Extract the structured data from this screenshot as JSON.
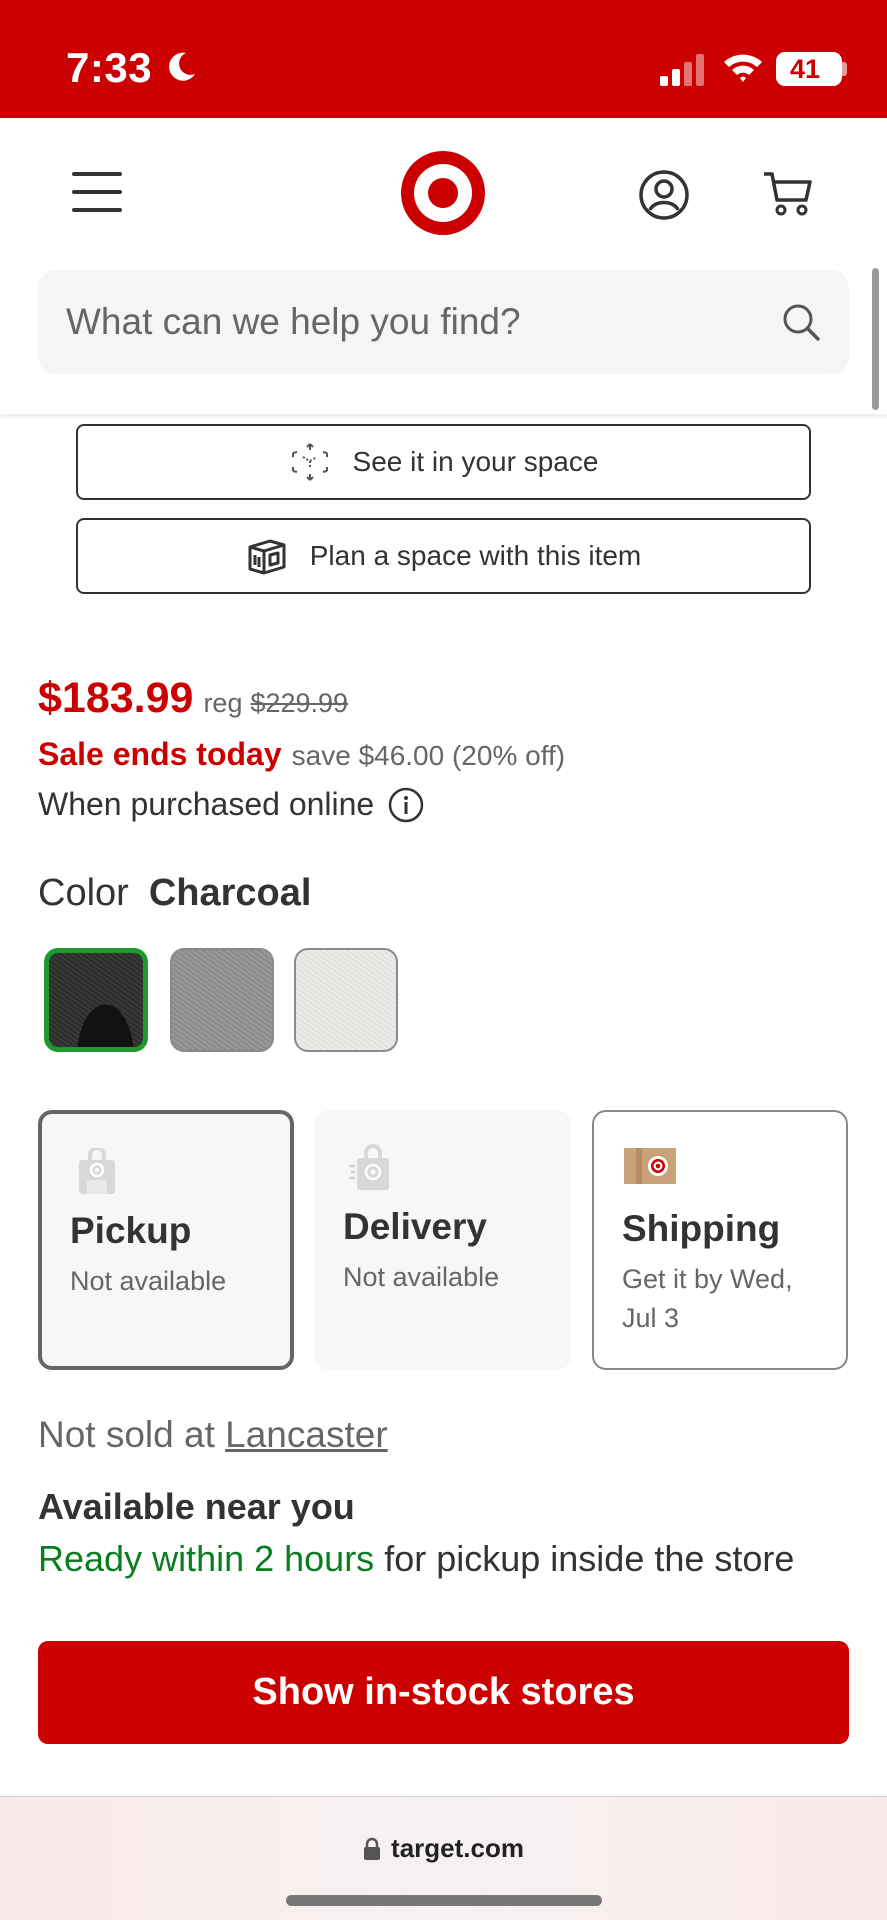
{
  "status_bar": {
    "time": "7:33",
    "battery": "41"
  },
  "header": {
    "search_placeholder": "What can we help you find?"
  },
  "actions": {
    "see_in_space": "See it in your space",
    "plan_space": "Plan a space with this item"
  },
  "pricing": {
    "price": "$183.99",
    "reg_label": "reg",
    "reg_price": "$229.99",
    "sale_ends": "Sale ends today",
    "save_text": "save $46.00 (20% off)",
    "purchased_online": "When purchased online"
  },
  "color": {
    "label": "Color",
    "selected": "Charcoal",
    "swatches": [
      "Charcoal",
      "Gray",
      "White"
    ]
  },
  "fulfillment": {
    "pickup": {
      "title": "Pickup",
      "status": "Not available"
    },
    "delivery": {
      "title": "Delivery",
      "status": "Not available"
    },
    "shipping": {
      "title": "Shipping",
      "status": "Get it by Wed, Jul 3"
    }
  },
  "store": {
    "not_sold_prefix": "Not sold at",
    "store_name": "Lancaster",
    "available_title": "Available near you",
    "ready_highlight": "Ready within 2 hours",
    "ready_rest": "for pickup inside the store"
  },
  "cta": {
    "show_stores": "Show in-stock stores"
  },
  "browser": {
    "url": "target.com"
  },
  "colors": {
    "brand_red": "#cc0000",
    "available_green": "#0a7d1f",
    "selected_swatch_border": "#1e9a2c"
  },
  "icons": [
    "moon-icon",
    "signal-icon",
    "wifi-icon",
    "menu-icon",
    "target-logo",
    "account-icon",
    "cart-icon",
    "search-icon",
    "ar-cube-icon",
    "room-planner-icon",
    "info-icon",
    "pickup-bag-icon",
    "delivery-bag-icon",
    "shipping-box-icon",
    "lock-icon"
  ]
}
